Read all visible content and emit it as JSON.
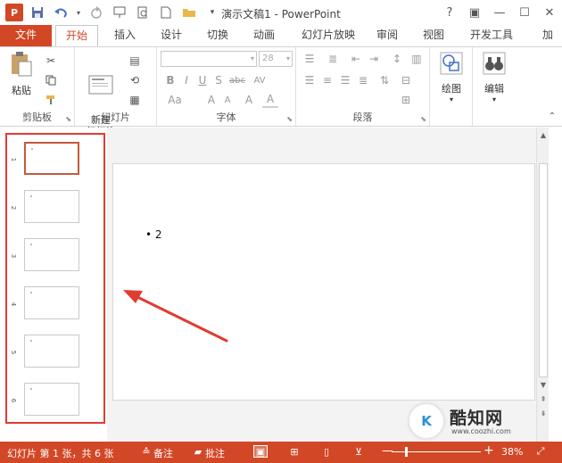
{
  "titlebar": {
    "title": "演示文稿1 - PowerPoint",
    "logo": "P",
    "qat_icons": [
      "save-icon",
      "undo-icon",
      "redo-icon",
      "presenter-icon",
      "print-preview-icon",
      "new-icon",
      "open-icon",
      "customize-icon"
    ],
    "controls": [
      "?",
      "▣",
      "—",
      "☐",
      "✕"
    ]
  },
  "tabs": {
    "file": "文件",
    "items": [
      "开始",
      "插入",
      "设计",
      "切换",
      "动画",
      "幻灯片放映",
      "审阅",
      "视图",
      "开发工具",
      "加"
    ],
    "active": "开始"
  },
  "ribbon": {
    "clipboard": {
      "label": "剪贴板",
      "paste": "粘贴"
    },
    "slides": {
      "label": "幻灯片",
      "new_slide": "新建\n幻灯片"
    },
    "font": {
      "label": "字体",
      "font_name": "",
      "font_size": "28",
      "buttons": [
        "B",
        "I",
        "U",
        "S",
        "abc",
        "AV",
        "Aa",
        "A",
        "A",
        "A",
        "A"
      ]
    },
    "paragraph": {
      "label": "段落"
    },
    "drawing": {
      "label": "绘图"
    },
    "editing": {
      "label": "编辑"
    }
  },
  "thumbnails": {
    "numbers": [
      "1",
      "2",
      "3",
      "4",
      "5",
      "6"
    ],
    "selected": 1
  },
  "slide": {
    "bullet_text": "• 2"
  },
  "watermark": {
    "logo_text": "K",
    "name": "酷知网",
    "url": "www.coozhi.com"
  },
  "statusbar": {
    "slide_info": "幻灯片 第 1 张，共 6 张",
    "notes": "备注",
    "comments": "批注",
    "zoom": "38%",
    "zoom_fraction": 0.38
  },
  "colors": {
    "accent": "#d24726",
    "highlight_border": "#e03c31",
    "arrow": "#e03c31"
  }
}
